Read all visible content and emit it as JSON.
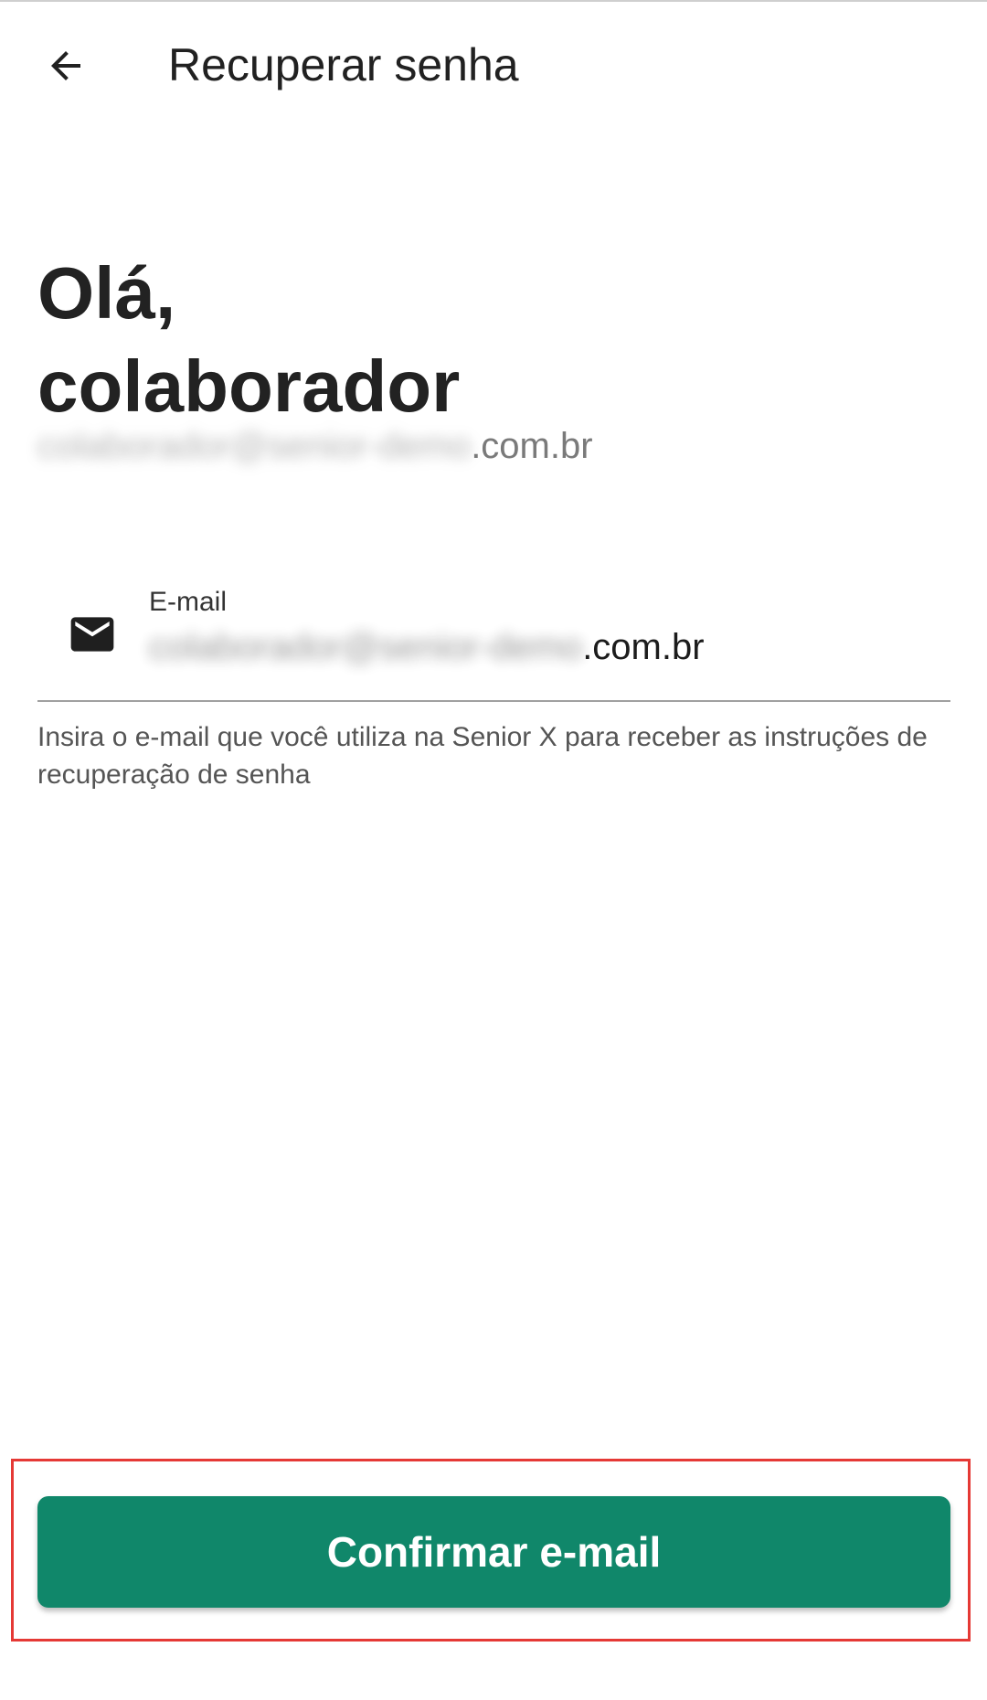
{
  "app_bar": {
    "title": "Recuperar senha",
    "back_icon": "arrow-left-icon"
  },
  "greeting": {
    "line1": "Olá,",
    "line2": "colaborador"
  },
  "account": {
    "email_redacted": "colaborador@senior-demo",
    "email_visible": ".com.br"
  },
  "email_field": {
    "icon": "mail-icon",
    "label": "E-mail",
    "value_redacted": "colaborador@senior-demo",
    "value_visible": ".com.br",
    "helper": "Insira o e-mail que você utiliza na Senior X para receber as instruções de recuperação de senha"
  },
  "confirm_button": {
    "label": "Confirmar e-mail",
    "color": "#10876a"
  },
  "highlight": {
    "color": "#e53935"
  }
}
